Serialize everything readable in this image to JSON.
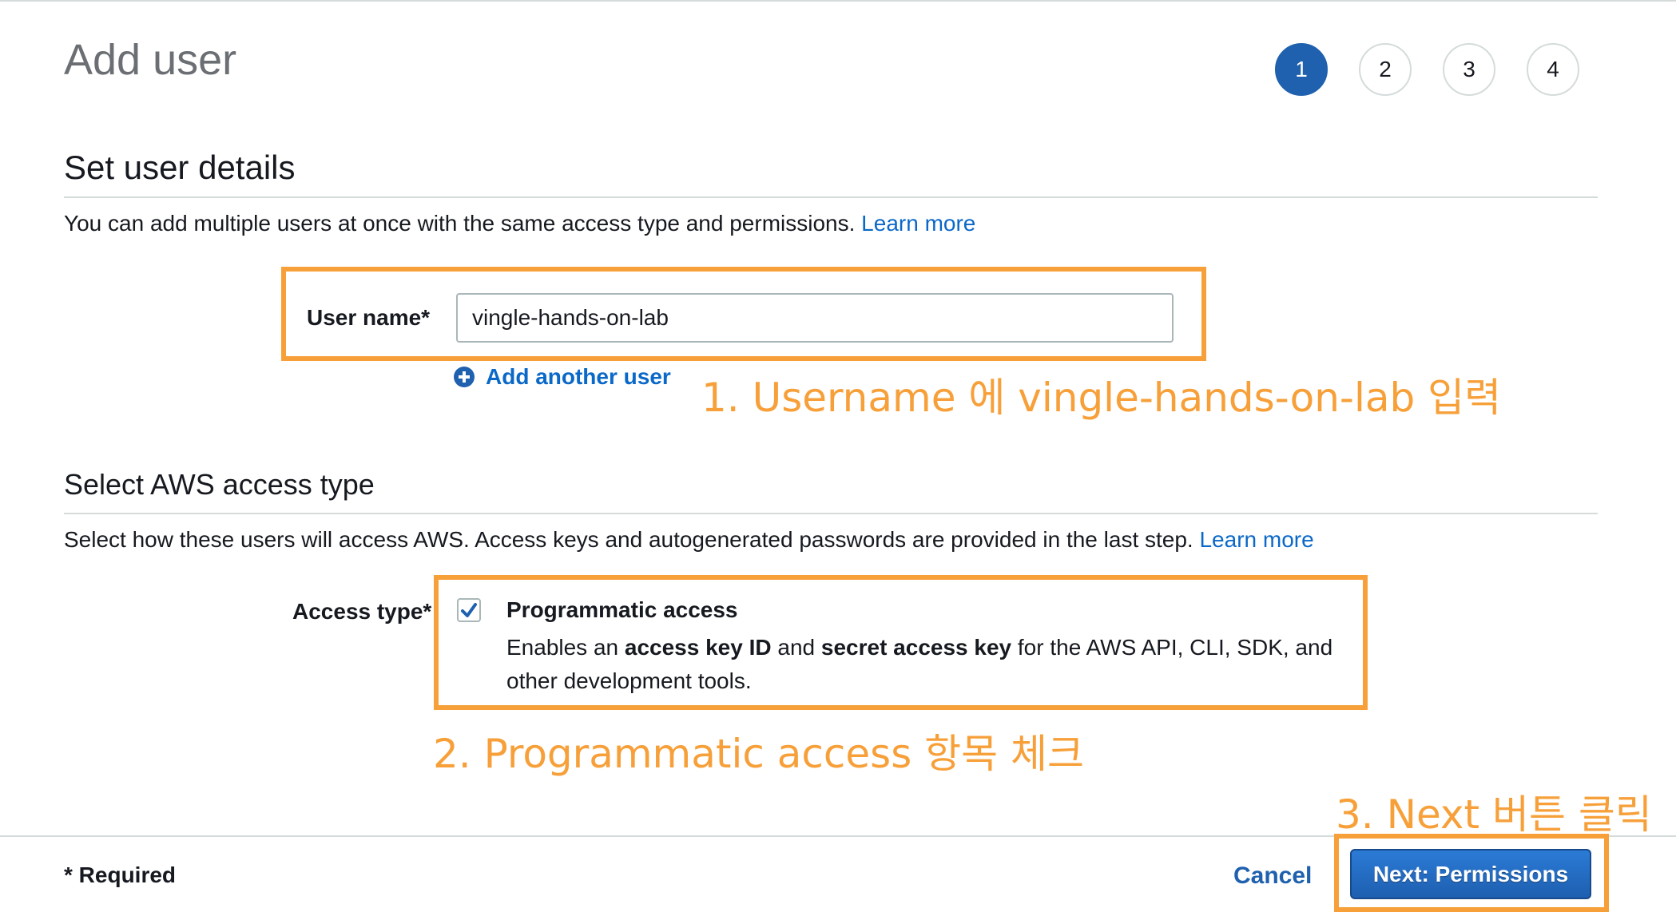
{
  "page": {
    "title": "Add user"
  },
  "steps": [
    "1",
    "2",
    "3",
    "4"
  ],
  "user_details": {
    "title": "Set user details",
    "description": "You can add multiple users at once with the same access type and permissions.",
    "learn_more": "Learn more",
    "username_label": "User name*",
    "username_value": "vingle-hands-on-lab",
    "add_another_user": "Add another user"
  },
  "access_type": {
    "title": "Select AWS access type",
    "description": "Select how these users will access AWS. Access keys and autogenerated passwords are provided in the last step.",
    "learn_more": "Learn more",
    "label": "Access type*",
    "option_title": "Programmatic access",
    "option_desc_part1": "Enables an ",
    "option_desc_bold1": "access key ID",
    "option_desc_part2": " and ",
    "option_desc_bold2": "secret access key",
    "option_desc_part3": " for the AWS API, CLI, SDK, and other development tools.",
    "checked": true
  },
  "annotations": {
    "step1": "1. Username 에 vingle-hands-on-lab 입력",
    "step2": "2. Programmatic access 항목 체크",
    "step3": "3. Next 버튼 클릭",
    "color": "#f7a03a"
  },
  "footer": {
    "required": "* Required",
    "cancel": "Cancel",
    "next": "Next: Permissions"
  },
  "colors": {
    "accent": "#1f61ae",
    "link": "#0a68c8",
    "annotation": "#f7a03a"
  }
}
